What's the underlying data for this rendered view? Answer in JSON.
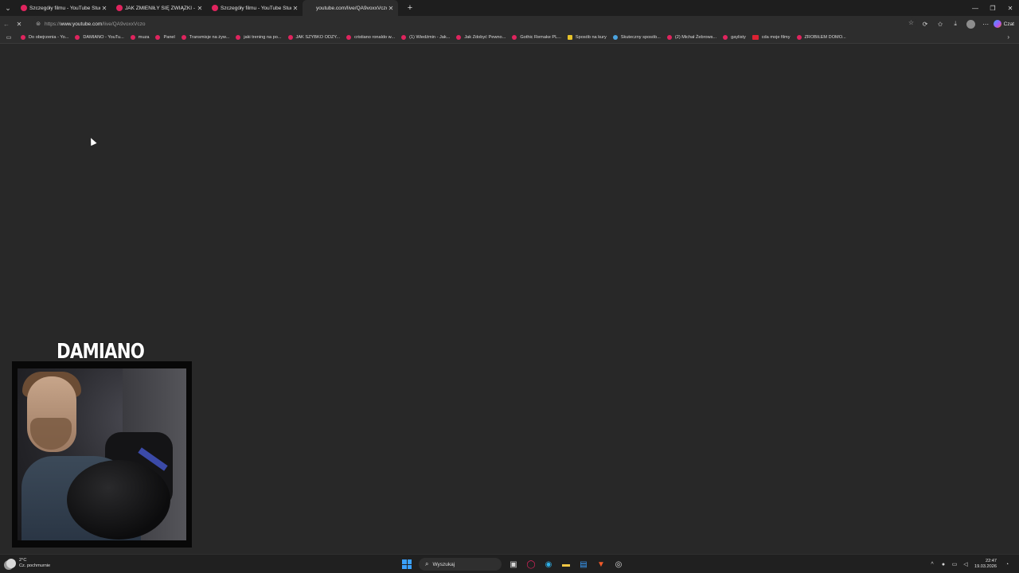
{
  "browser": {
    "tabs": [
      {
        "title": "Szczegóły filmu - YouTube Studio",
        "active": false
      },
      {
        "title": "JAK ZMIENIŁY SIĘ ZWIĄZKI - YouTube",
        "active": false
      },
      {
        "title": "Szczegóły filmu - YouTube Studio",
        "active": false
      },
      {
        "title": "youtube.com/live/QA9voxxVczo",
        "active": true
      }
    ],
    "address": {
      "prefix": "https://",
      "host": "www.youtube.com",
      "path": "/live/QA9voxxVczo"
    },
    "copilot_label": "Czat",
    "bookmarks": [
      {
        "label": "Do obejrzenia - Yo...",
        "icon": "youtube"
      },
      {
        "label": "DAMIANO - YouTu...",
        "icon": "youtube"
      },
      {
        "label": "muza",
        "icon": "youtube"
      },
      {
        "label": "Panel",
        "icon": "youtube"
      },
      {
        "label": "Transmisje na żyw...",
        "icon": "youtube"
      },
      {
        "label": "jaki trening na po...",
        "icon": "youtube"
      },
      {
        "label": "JAK SZYBKO ODZY...",
        "icon": "youtube"
      },
      {
        "label": "cristiano ronaldo w...",
        "icon": "youtube"
      },
      {
        "label": "(1) Wiedźmin - Jak...",
        "icon": "youtube"
      },
      {
        "label": "Jak Zdobyć Pewno...",
        "icon": "youtube"
      },
      {
        "label": "Gothic Remake PL...",
        "icon": "youtube"
      },
      {
        "label": "Sposób na kury",
        "icon": "doc"
      },
      {
        "label": "Skuteczny sposób...",
        "icon": "shield"
      },
      {
        "label": "(2) Michał Żebrows...",
        "icon": "youtube"
      },
      {
        "label": "gaylisty",
        "icon": "youtube"
      },
      {
        "label": "cda moje filmy",
        "icon": "cda"
      },
      {
        "label": "ZROBIŁEM DOMO...",
        "icon": "youtube"
      }
    ]
  },
  "stream_overlay": {
    "name": "DAMIANO"
  },
  "taskbar": {
    "weather_temp": "2°C",
    "weather_desc": "Cz. pochmurnie",
    "search_placeholder": "Wyszukaj",
    "time": "22:47",
    "date": "19.03.2026"
  },
  "colors": {
    "page_bg": "#282828",
    "chrome_bg": "#2d2d2d",
    "tab_strip_bg": "#1e1e1e",
    "youtube_red": "#e0245e",
    "taskbar_bg": "#202020"
  }
}
